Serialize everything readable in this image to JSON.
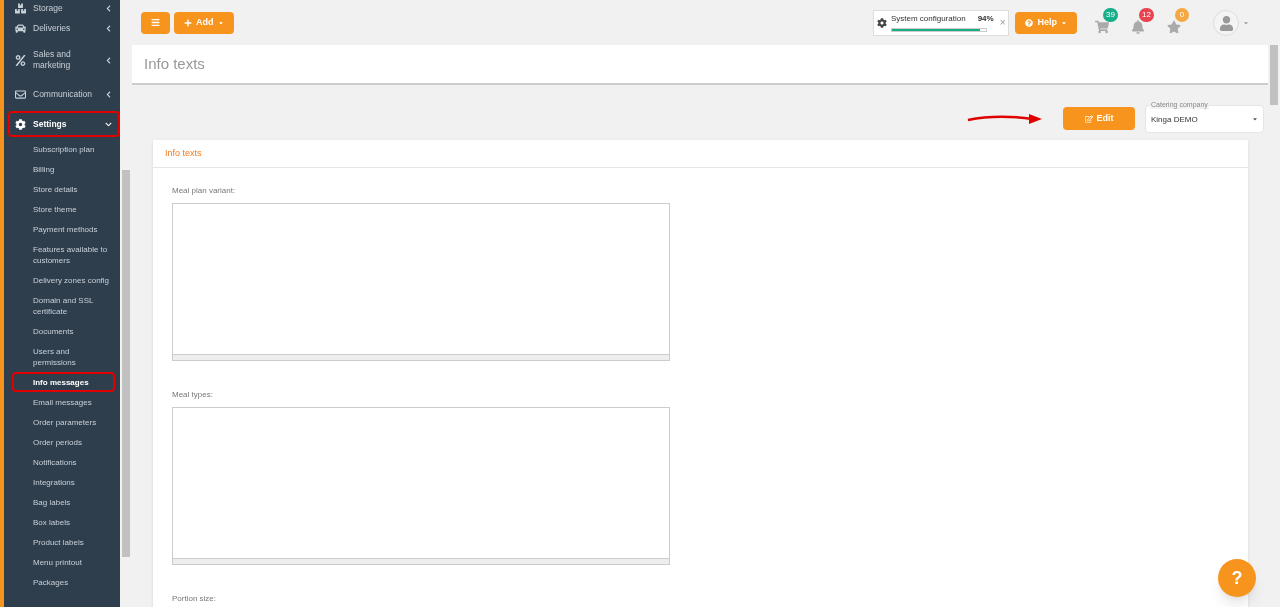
{
  "sidebar": {
    "items": [
      {
        "label": "Storage",
        "expanded": false
      },
      {
        "label": "Deliveries",
        "expanded": false
      },
      {
        "label": "Sales and marketing",
        "expanded": false
      },
      {
        "label": "Communication",
        "expanded": false
      },
      {
        "label": "Settings",
        "expanded": true,
        "selected": true,
        "children": [
          {
            "label": "Subscription plan",
            "selected": false
          },
          {
            "label": "Billing",
            "selected": false
          },
          {
            "label": "Store details",
            "selected": false
          },
          {
            "label": "Store theme",
            "selected": false
          },
          {
            "label": "Payment methods",
            "selected": false
          },
          {
            "label": "Features available to customers",
            "selected": false
          },
          {
            "label": "Delivery zones config",
            "selected": false
          },
          {
            "label": "Domain and SSL certificate",
            "selected": false
          },
          {
            "label": "Documents",
            "selected": false
          },
          {
            "label": "Users and permissions",
            "selected": false
          },
          {
            "label": "Info messages",
            "selected": true
          },
          {
            "label": "Email messages",
            "selected": false
          },
          {
            "label": "Order parameters",
            "selected": false
          },
          {
            "label": "Order periods",
            "selected": false
          },
          {
            "label": "Notifications",
            "selected": false
          },
          {
            "label": "Integrations",
            "selected": false
          },
          {
            "label": "Bag labels",
            "selected": false
          },
          {
            "label": "Box labels",
            "selected": false
          },
          {
            "label": "Product labels",
            "selected": false
          },
          {
            "label": "Menu printout",
            "selected": false
          },
          {
            "label": "Packages",
            "selected": false
          }
        ]
      }
    ]
  },
  "toolbar": {
    "add_label": "Add",
    "system_config": {
      "label": "System configuration",
      "percent": "94%",
      "level": 0.94,
      "close_symbol": "×"
    },
    "help_label": "Help",
    "badges": [
      {
        "kind": "cart",
        "count": "39",
        "color": "#1aae88"
      },
      {
        "kind": "bell",
        "count": "12",
        "color": "#e8434f"
      },
      {
        "kind": "star",
        "count": "0",
        "color": "#f5a742"
      }
    ]
  },
  "page_title": "Info texts",
  "edit_label": "Edit",
  "catering_company": {
    "label": "Catering company",
    "value": "Kinga DEMO"
  },
  "panel": {
    "title": "Info texts",
    "fields": [
      {
        "label": "Meal plan variant:"
      },
      {
        "label": "Meal types:"
      },
      {
        "label": "Portion size:"
      }
    ]
  },
  "help_fab": "?"
}
